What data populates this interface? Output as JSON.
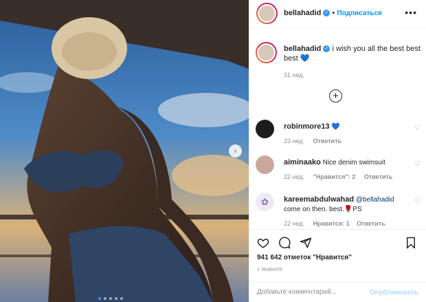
{
  "post": {
    "author": "bellahadid",
    "follow_label": "Подписаться",
    "more_label": "•••",
    "carousel_next": "›"
  },
  "caption": {
    "author": "bellahadid",
    "text": "i wish you all the best best best 💙",
    "time": "31 нед."
  },
  "add_more_label": "+",
  "comments": [
    {
      "author": "robinmore13",
      "text": "💙",
      "time": "23 нед.",
      "likes": "",
      "reply_label": "Ответить"
    },
    {
      "author": "aiminaako",
      "text": "Nice denim swimsuit",
      "time": "22 нед.",
      "likes": "\"Нравится\": 2",
      "reply_label": "Ответить"
    },
    {
      "author": "kareemabdulwahad",
      "mention": "@bellahadid",
      "text": "come on then. best.🌹PS",
      "time": "22 нед.",
      "likes": "Нравится: 1",
      "reply_label": "Ответить"
    }
  ],
  "stats": {
    "likes": "941 642 отметок \"Нравится\"",
    "date": "1 ЯНВАРЯ"
  },
  "composer": {
    "placeholder": "Добавьте комментарий...",
    "publish_label": "Опубликовать"
  },
  "icons": {
    "heart": "heart-icon",
    "comment": "comment-icon",
    "share": "share-icon",
    "save": "bookmark-icon",
    "emoji": "emoji-icon"
  },
  "colors": {
    "accent": "#0095f6",
    "verified": "#3897f0",
    "publish_disabled": "#b3dbff"
  }
}
